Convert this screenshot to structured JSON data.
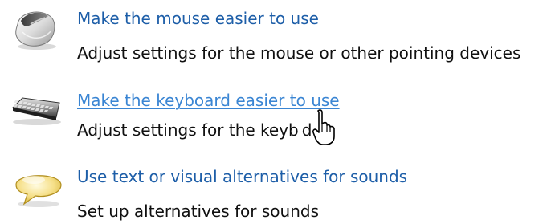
{
  "items": [
    {
      "link": "Make the mouse easier to use",
      "description": "Adjust settings for the mouse or other pointing devices",
      "icon": "mouse-icon"
    },
    {
      "link": "Make the keyboard easier to use",
      "description": "Adjust settings for the keyb d",
      "icon": "keyboard-icon"
    },
    {
      "link": "Use text or visual alternatives for sounds",
      "description": "Set up alternatives for sounds",
      "icon": "speech-bubble-icon"
    }
  ],
  "cursor": "hand-pointer-cursor",
  "colors": {
    "link": "#1d5ea8",
    "link_hover": "#3a85d3",
    "text": "#101010"
  }
}
